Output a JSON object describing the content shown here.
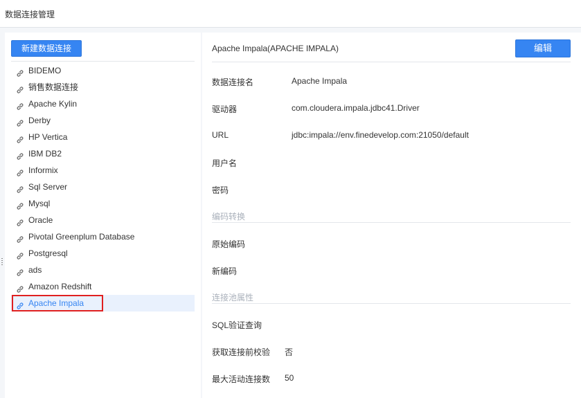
{
  "page": {
    "title": "数据连接管理"
  },
  "left": {
    "new_button": "新建数据连接",
    "connections": [
      {
        "name": "BIDEMO"
      },
      {
        "name": "销售数据连接"
      },
      {
        "name": "Apache Kylin"
      },
      {
        "name": "Derby"
      },
      {
        "name": "HP Vertica"
      },
      {
        "name": "IBM DB2"
      },
      {
        "name": "Informix"
      },
      {
        "name": "Sql Server"
      },
      {
        "name": "Mysql"
      },
      {
        "name": "Oracle"
      },
      {
        "name": "Pivotal Greenplum Database"
      },
      {
        "name": "Postgresql"
      },
      {
        "name": "ads"
      },
      {
        "name": "Amazon Redshift"
      },
      {
        "name": "Apache Impala",
        "selected": true
      }
    ],
    "item_icon": "link-icon"
  },
  "detail": {
    "header_title": "Apache Impala(APACHE IMPALA)",
    "edit_button": "编辑",
    "fields": {
      "name_label": "数据连接名",
      "name_value": "Apache Impala",
      "driver_label": "驱动器",
      "driver_value": "com.cloudera.impala.jdbc41.Driver",
      "url_label": "URL",
      "url_value": "jdbc:impala://env.finedevelop.com:21050/default",
      "user_label": "用户名",
      "password_label": "密码"
    },
    "encoding_section": {
      "title": "编码转换",
      "original_label": "原始编码",
      "new_label": "新编码"
    },
    "pool_section": {
      "title": "连接池属性",
      "sql_validate_label": "SQL验证查询",
      "test_before_label": "获取连接前校验",
      "test_before_value": "否",
      "max_active_label": "最大活动连接数",
      "max_active_value": "50"
    }
  },
  "colors": {
    "accent": "#3685f2",
    "highlight_border": "#e02020",
    "selected_bg": "#e9f1fd"
  }
}
